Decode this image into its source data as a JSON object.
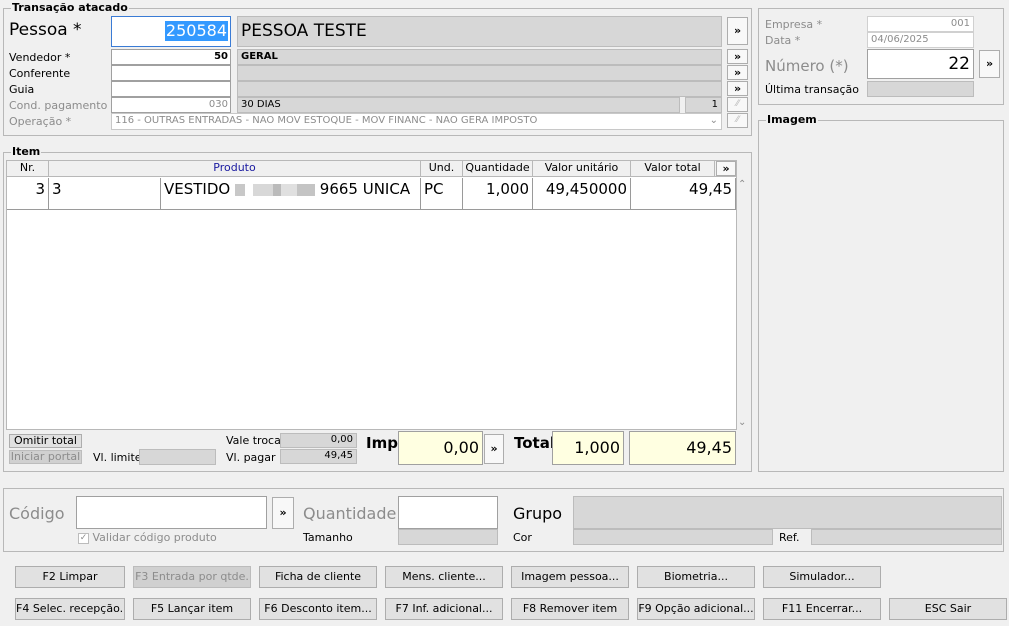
{
  "transaction_group": {
    "title": "Transação atacado"
  },
  "pessoa": {
    "label": "Pessoa *",
    "code": "250584",
    "name": "PESSOA TESTE"
  },
  "vendedor": {
    "label": "Vendedor *",
    "code": "50",
    "name": "GERAL"
  },
  "conferente": {
    "label": "Conferente"
  },
  "guia": {
    "label": "Guia"
  },
  "cond_pagamento": {
    "label": "Cond. pagamento *",
    "code": "030",
    "name": "30 DIAS",
    "extra": "1"
  },
  "operacao": {
    "label": "Operação *",
    "value": "116 - OUTRAS ENTRADAS - NAO MOV ESTOQUE - MOV FINANC - NAO GERA IMPOSTO"
  },
  "right_panel": {
    "empresa_label": "Empresa *",
    "empresa_value": "001",
    "data_label": "Data *",
    "data_value": "04/06/2025",
    "numero_label": "Número (*)",
    "numero_value": "22",
    "ultima_label": "Última transação"
  },
  "image_group": {
    "title": "Imagem"
  },
  "item_group": {
    "title": "Item"
  },
  "table": {
    "headers": {
      "nr": "Nr.",
      "produto": "Produto",
      "und": "Und.",
      "quantidade": "Quantidade",
      "valor_unitario": "Valor unitário",
      "valor_total": "Valor total"
    },
    "rows": [
      {
        "nr": "3",
        "code": "3",
        "desc_a": "VESTIDO",
        "desc_b": "9665 UNICA",
        "und": "PC",
        "quantidade": "1,000",
        "valor_unitario": "49,450000",
        "valor_total": "49,45"
      }
    ]
  },
  "footer_totals": {
    "omitir_total": "Omitir total",
    "iniciar_portal": "Iniciar portal",
    "vl_limite_label": "Vl. limite",
    "vale_troca_label": "Vale troca",
    "vale_troca_value": "0,00",
    "vl_pagar_label": "Vl. pagar",
    "vl_pagar_value": "49,45",
    "imp_label": "Imp.",
    "imp_value": "0,00",
    "total_label": "Total",
    "total_qty": "1,000",
    "total_value": "49,45"
  },
  "entry": {
    "codigo_label": "Código",
    "validar_label": "Validar código produto",
    "quantidade_label": "Quantidade",
    "tamanho_label": "Tamanho",
    "grupo_label": "Grupo",
    "cor_label": "Cor",
    "ref_label": "Ref."
  },
  "buttons": {
    "more": "»",
    "f2": "F2 Limpar",
    "f3": "F3 Entrada por qtde.",
    "ficha": "Ficha de cliente",
    "mens": "Mens. cliente...",
    "imagem": "Imagem pessoa...",
    "biometria": "Biometria...",
    "simulador": "Simulador...",
    "f4": "F4 Selec. recepção..",
    "f5": "F5 Lançar item",
    "f6": "F6 Desconto item...",
    "f7": "F7 Inf. adicional...",
    "f8": "F8 Remover item",
    "f9": "F9 Opção adicional...",
    "f11": "F11 Encerrar...",
    "esc": "ESC Sair"
  }
}
